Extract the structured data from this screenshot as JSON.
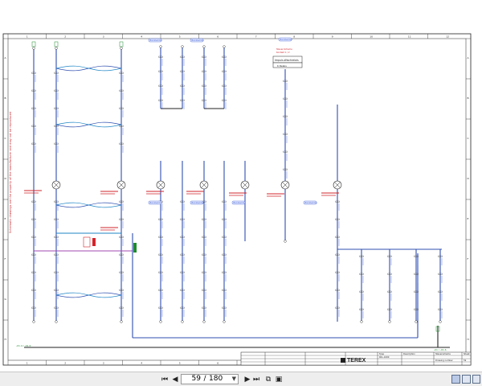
{
  "document": {
    "column_numbers": [
      "1",
      "2",
      "3",
      "4",
      "5",
      "6",
      "7",
      "8",
      "9",
      "10",
      "11",
      "12"
    ],
    "row_letters": [
      "A",
      "B",
      "C",
      "D",
      "E",
      "F",
      "G",
      "H"
    ],
    "side_note": "Schematic drawings are the property of the manufacturer and may not be reproduced",
    "callout_label": "Bornklemme",
    "relay_note_title": "Impuls-Wischrelais",
    "relay_note_lines": [
      "Steuer-Schema",
      "Kontakt 1 / 2"
    ],
    "top_box_label": "K Relais",
    "brand": "TEREX",
    "title_block": {
      "description": "Description",
      "description_value": "Steuerschema",
      "type_label": "Type",
      "type_value": "RCL-1000",
      "drawing_number_label": "Drawing number",
      "sheet_label": "Sheet",
      "sheet_value": "59"
    },
    "bottom_left_tag": "-X1.4 / -X1.5",
    "bottom_right_tag": "-X1 / -X1.6"
  },
  "toolbar": {
    "first_page_icon": "first-page-icon",
    "prev_page_icon": "previous-page-icon",
    "current_page": "59",
    "separator": "/",
    "total_pages": "180",
    "next_page_icon": "next-page-icon",
    "last_page_icon": "last-page-icon",
    "colors": {
      "background": "#eeeeee",
      "accent": "#2f4f9f"
    }
  },
  "colors": {
    "wire_blue": "#2f4fb0",
    "wire_cyan": "#1f86c6",
    "wire_magenta": "#a04ab0",
    "line_black": "#222222",
    "label_red": "#d2242b",
    "label_green": "#1e8a2e"
  }
}
